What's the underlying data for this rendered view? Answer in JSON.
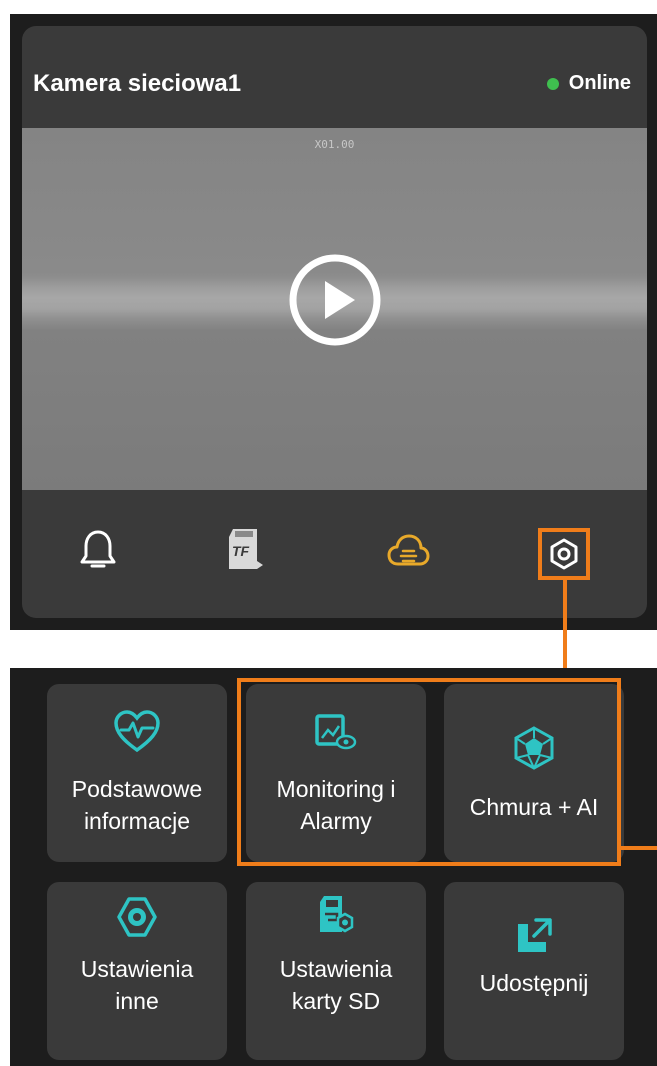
{
  "camera": {
    "name": "Kamera sieciowa1",
    "status": "Online",
    "status_color": "#3fbf4f",
    "zoom": "X01.00"
  },
  "toolbar": {
    "items": [
      {
        "icon": "bell-icon"
      },
      {
        "icon": "tf-card-icon",
        "label": "TF"
      },
      {
        "icon": "cloud-icon"
      },
      {
        "icon": "settings-hexagon-icon",
        "highlighted": true
      }
    ]
  },
  "accent_color": "#f07d1a",
  "icon_color": "#2ec4c4",
  "menu": {
    "tiles": [
      {
        "label_line1": "Podstawowe",
        "label_line2": "informacje",
        "icon": "heart-pulse-icon"
      },
      {
        "label_line1": "Monitoring i",
        "label_line2": "Alarmy",
        "icon": "monitor-eye-icon"
      },
      {
        "label_line1": "Chmura + AI",
        "label_line2": "",
        "icon": "ai-polyhedron-icon"
      },
      {
        "label_line1": "Ustawienia",
        "label_line2": "inne",
        "icon": "hexagon-settings-icon"
      },
      {
        "label_line1": "Ustawienia",
        "label_line2": "karty SD",
        "icon": "sd-card-settings-icon"
      },
      {
        "label_line1": "Udostępnij",
        "label_line2": "",
        "icon": "share-icon"
      }
    ]
  }
}
